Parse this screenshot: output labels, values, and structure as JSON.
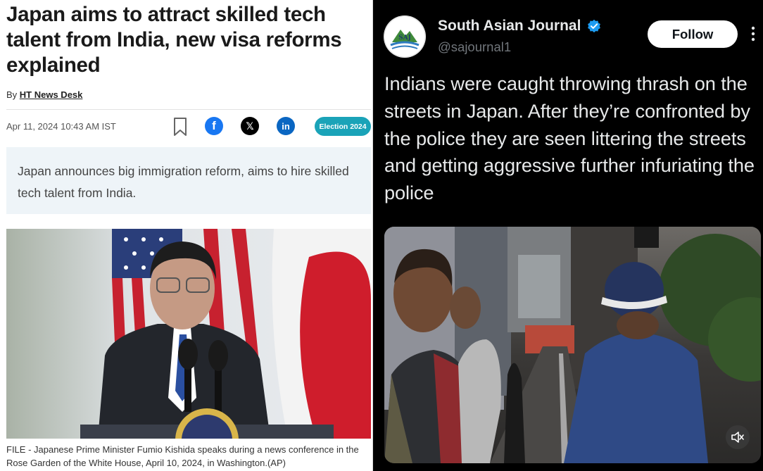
{
  "article": {
    "headline": "Japan aims to attract skilled tech talent from India, new visa reforms explained",
    "byline_prefix": "By ",
    "author": "HT News Desk",
    "dateline": "Apr 11, 2024 10:43 AM IST",
    "share_x_glyph": "𝕏",
    "share_fb_glyph": "f",
    "share_li_glyph": "in",
    "election_badge": "Election 2024",
    "summary": "Japan announces big immigration reform, aims to hire skilled tech talent from India.",
    "caption": "FILE - Japanese Prime Minister Fumio Kishida speaks during a news conference in the Rose Garden of the White House, April 10, 2024, in Washington.(AP)",
    "colors": {
      "facebook": "#1877f2",
      "linkedin": "#0a66c2",
      "badge": "#1aa3b8",
      "summary_bg": "#eef4f8"
    }
  },
  "tweet": {
    "account_name": "South Asian Journal",
    "handle": "@sajournal1",
    "avatar_text": "SAJ",
    "follow_label": "Follow",
    "text": "Indians were caught throwing thrash on the streets in Japan. After they’re confronted by the police they are seen littering the streets and getting aggressive further infuriating the police",
    "video_sign": "Y",
    "colors": {
      "background": "#000000",
      "text": "#e7e9ea",
      "handle": "#71767b",
      "verified": "#1d9bf0"
    }
  }
}
